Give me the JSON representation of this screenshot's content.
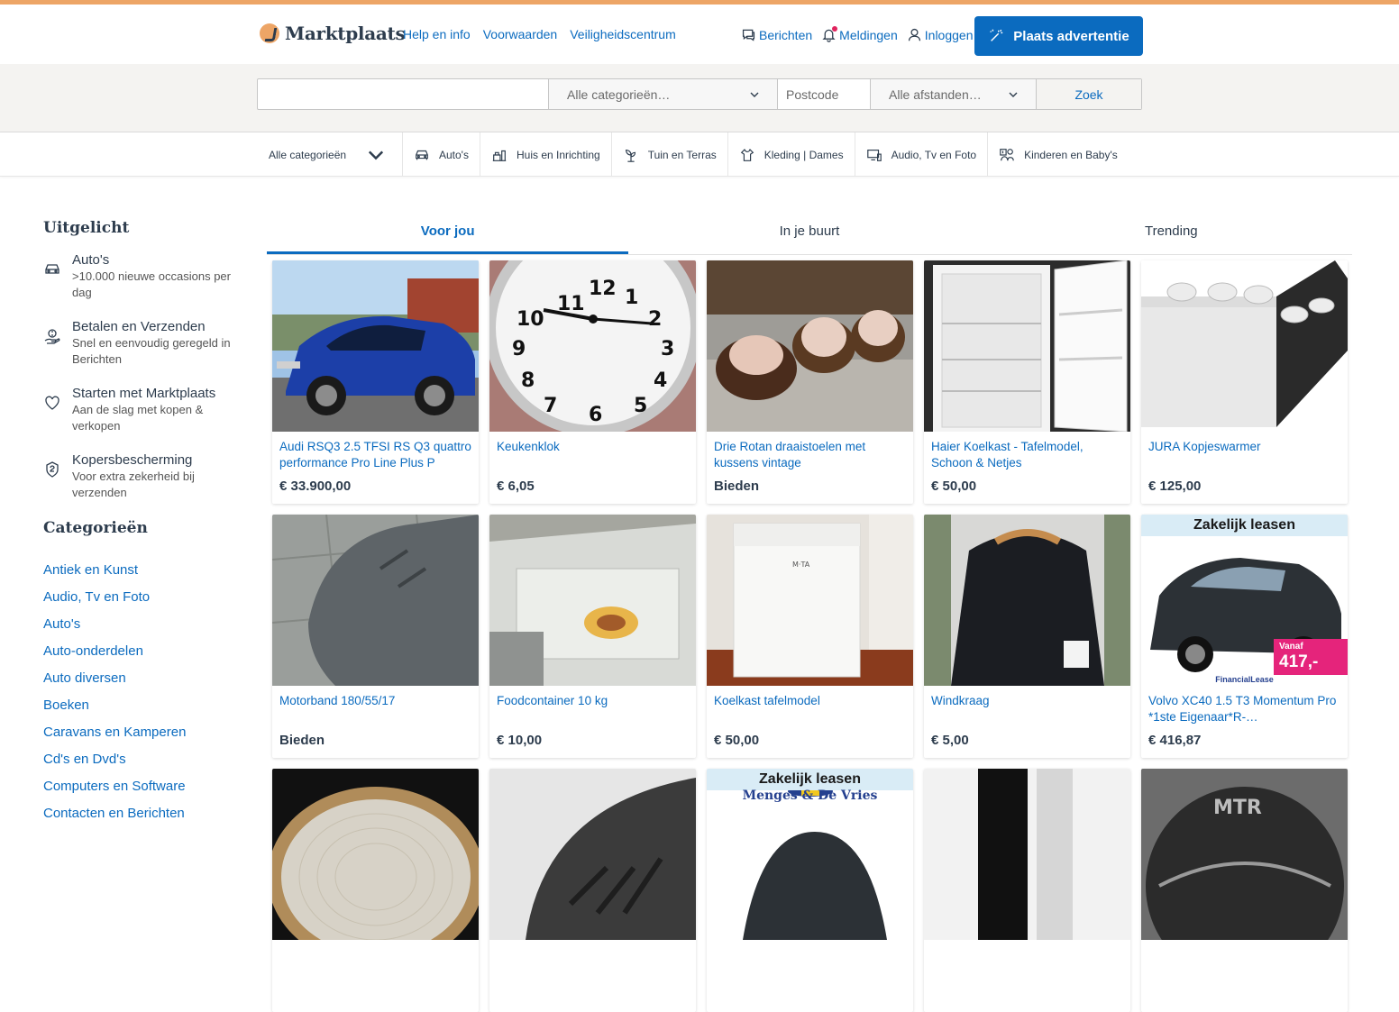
{
  "header": {
    "logo_text": "Marktplaats",
    "links": [
      "Help en info",
      "Voorwaarden",
      "Veiligheidscentrum"
    ],
    "messages": "Berichten",
    "notifications": "Meldingen",
    "login": "Inloggen",
    "place_ad": "Plaats advertentie"
  },
  "search": {
    "query_placeholder": "",
    "category": "Alle categorieën…",
    "postcode_placeholder": "Postcode",
    "distance": "Alle afstanden…",
    "button": "Zoek"
  },
  "category_bar": {
    "all": "Alle categorieën",
    "items": [
      {
        "label": "Auto's",
        "icon": "car-icon"
      },
      {
        "label": "Huis en Inrichting",
        "icon": "home-icon"
      },
      {
        "label": "Tuin en Terras",
        "icon": "plant-icon"
      },
      {
        "label": "Kleding | Dames",
        "icon": "clothing-icon"
      },
      {
        "label": "Audio, Tv en Foto",
        "icon": "tv-icon"
      },
      {
        "label": "Kinderen en Baby's",
        "icon": "kids-icon"
      }
    ]
  },
  "sidebar": {
    "featured_heading": "Uitgelicht",
    "featured": [
      {
        "title": "Auto's",
        "desc": ">10.000 nieuwe occasions per dag",
        "icon": "car-icon"
      },
      {
        "title": "Betalen en Verzenden",
        "desc": "Snel en eenvoudig geregeld in Berichten",
        "icon": "payment-icon"
      },
      {
        "title": "Starten met Marktplaats",
        "desc": "Aan de slag met kopen & verkopen",
        "icon": "heart-icon"
      },
      {
        "title": "Kopersbescherming",
        "desc": "Voor extra zekerheid bij verzenden",
        "icon": "shield-icon"
      }
    ],
    "categories_heading": "Categorieën",
    "categories": [
      "Antiek en Kunst",
      "Audio, Tv en Foto",
      "Auto's",
      "Auto-onderdelen",
      "Auto diversen",
      "Boeken",
      "Caravans en Kamperen",
      "Cd's en Dvd's",
      "Computers en Software",
      "Contacten en Berichten"
    ]
  },
  "tabs": [
    "Voor jou",
    "In je buurt",
    "Trending"
  ],
  "listings": [
    {
      "title": "Audi RSQ3 2.5 TFSI RS Q3 quattro performance Pro Line Plus P",
      "price": "€ 33.900,00",
      "img": "car-blue"
    },
    {
      "title": "Keukenklok",
      "price": "€ 6,05",
      "img": "clock"
    },
    {
      "title": "Drie Rotan draaistoelen met kussens vintage",
      "price": "Bieden",
      "img": "chairs"
    },
    {
      "title": "Haier Koelkast - Tafelmodel, Schoon & Netjes",
      "price": "€ 50,00",
      "img": "fridge-open"
    },
    {
      "title": "JURA Kopjeswarmer",
      "price": "€ 125,00",
      "img": "cupwarmer"
    },
    {
      "title": "Motorband 180/55/17",
      "price": "Bieden",
      "img": "tyre"
    },
    {
      "title": "Foodcontainer 10 kg",
      "price": "€ 10,00",
      "img": "container"
    },
    {
      "title": "Koelkast tafelmodel",
      "price": "€ 50,00",
      "img": "fridge"
    },
    {
      "title": "Windkraag",
      "price": "€ 5,00",
      "img": "jacket"
    },
    {
      "title": "Volvo XC40 1.5 T3 Momentum Pro *1ste Eigenaar*R-…",
      "price": "€ 416,87",
      "img": "volvo",
      "lease_label": "Zakelijk leasen",
      "badge_small": "Vanaf",
      "badge_big": "417,-",
      "footer": "FinancialLease"
    },
    {
      "title": "",
      "price": "",
      "img": "mat"
    },
    {
      "title": "",
      "price": "",
      "img": "tyre2"
    },
    {
      "title": "",
      "price": "",
      "img": "lease2",
      "lease_label": "Zakelijk leasen",
      "lease_sub": "Menges & De Vries"
    },
    {
      "title": "",
      "price": "",
      "img": "boots"
    },
    {
      "title": "",
      "price": "",
      "img": "helmet",
      "brand": "MTR"
    }
  ]
}
